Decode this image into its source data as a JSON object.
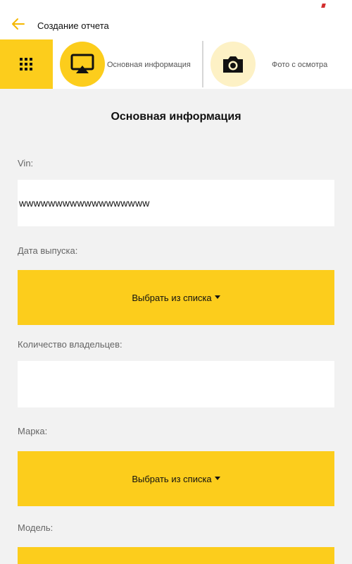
{
  "header": {
    "title": "Создание отчета",
    "back_icon": "arrow-left-icon",
    "accent_color": "#fccd1c"
  },
  "tabs": [
    {
      "label": "Основная информация",
      "icon": "airplay-screen-icon",
      "active": true
    },
    {
      "label": "Фото с осмотра",
      "icon": "camera-icon",
      "active": false
    }
  ],
  "menu_icon": "grid-menu-icon",
  "form": {
    "section_title": "Основная информация",
    "vin_label": "Vin:",
    "vin_value": "wwwwwwwwwwwwwwwwww",
    "release_date_label": "Дата выпуска:",
    "release_date_select": "Выбрать из списка",
    "owners_label": "Количество владельцев:",
    "owners_value": "",
    "brand_label": "Марка:",
    "brand_select": "Выбрать из списка",
    "model_label": "Модель:"
  }
}
